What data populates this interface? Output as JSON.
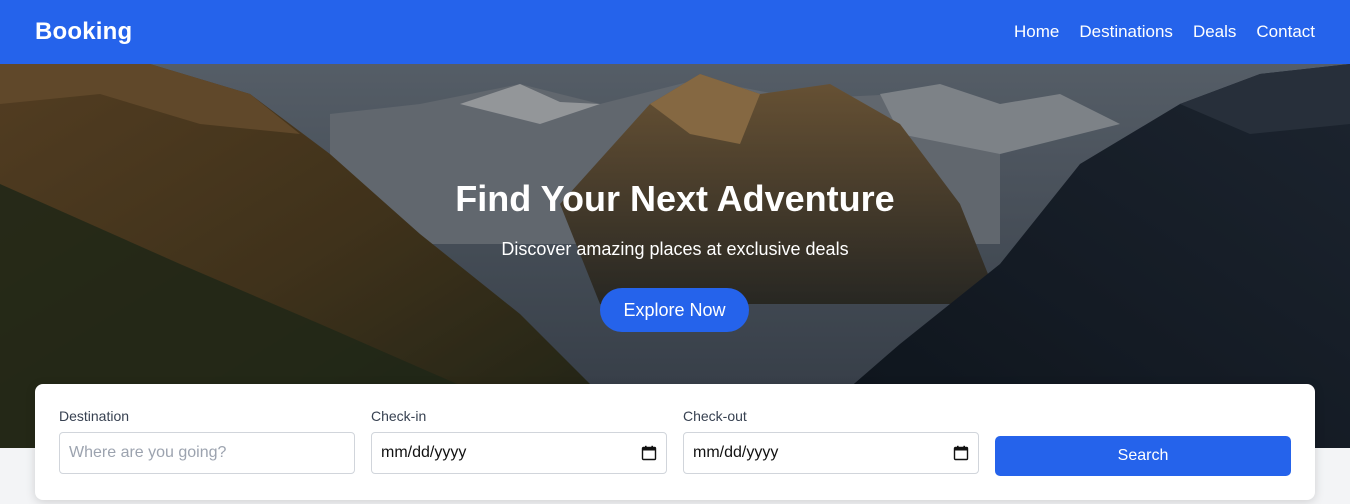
{
  "navbar": {
    "brand": "Booking",
    "links": [
      "Home",
      "Destinations",
      "Deals",
      "Contact"
    ]
  },
  "hero": {
    "title": "Find Your Next Adventure",
    "subtitle": "Discover amazing places at exclusive deals",
    "button": "Explore Now"
  },
  "search": {
    "destination": {
      "label": "Destination",
      "placeholder": "Where are you going?",
      "value": ""
    },
    "checkin": {
      "label": "Check-in",
      "value": "mm/dd/yyyy"
    },
    "checkout": {
      "label": "Check-out",
      "value": "mm/dd/yyyy"
    },
    "button": "Search"
  },
  "colors": {
    "primary": "#2563eb",
    "page_bg": "#f3f4f6"
  }
}
